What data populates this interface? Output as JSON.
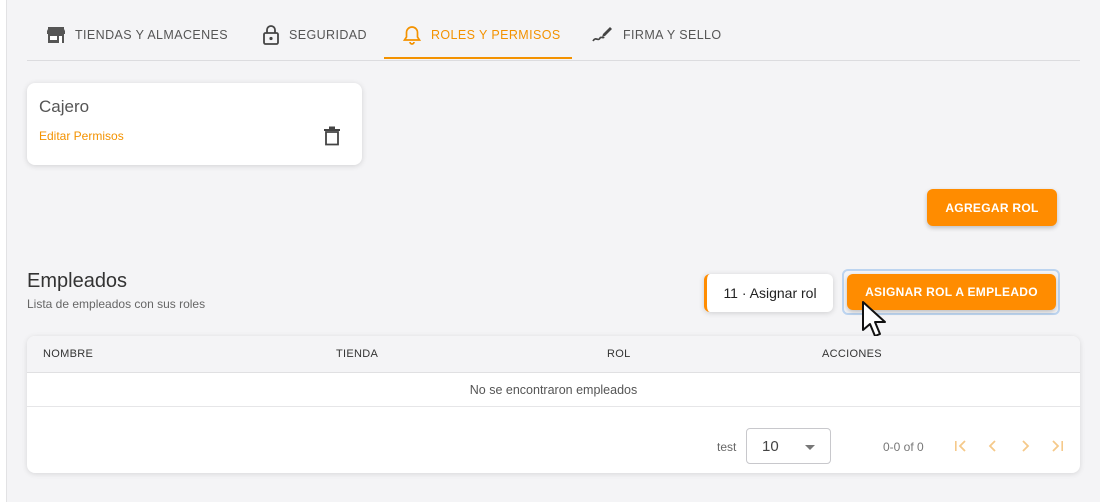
{
  "tabs": [
    {
      "label": "TIENDAS Y ALMACENES",
      "icon": "store-icon",
      "active": false
    },
    {
      "label": "SEGURIDAD",
      "icon": "lock-icon",
      "active": false
    },
    {
      "label": "ROLES Y PERMISOS",
      "icon": "bell-icon",
      "active": true
    },
    {
      "label": "FIRMA Y SELLO",
      "icon": "signature-icon",
      "active": false
    }
  ],
  "roles": [
    {
      "name": "Cajero",
      "edit_label": "Editar Permisos",
      "delete_icon": "trash-icon"
    }
  ],
  "add_role_label": "AGREGAR ROL",
  "employees": {
    "title": "Empleados",
    "subtitle": "Lista de empleados con sus roles",
    "assign_label": "ASIGNAR ROL A EMPLEADO",
    "tooltip": "11 · Asignar rol"
  },
  "table": {
    "headers": [
      "NOMBRE",
      "TIENDA",
      "ROL",
      "ACCIONES"
    ],
    "empty_message": "No se encontraron empleados",
    "rows": []
  },
  "pagination": {
    "rows_label": "test",
    "rows_per_page": "10",
    "range": "0-0 of 0",
    "icons": [
      "first-page-icon",
      "prev-page-icon",
      "next-page-icon",
      "last-page-icon"
    ]
  },
  "colors": {
    "accent": "#ff8c00",
    "tab_active": "#f39200",
    "background": "#f4f4f6"
  }
}
